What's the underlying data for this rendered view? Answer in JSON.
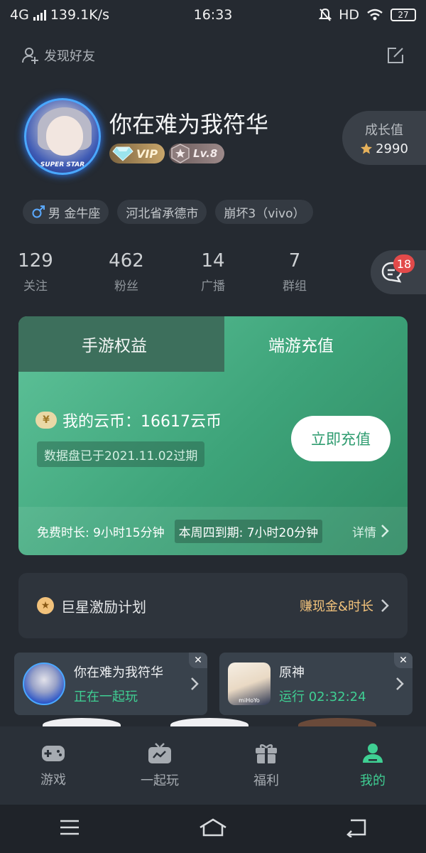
{
  "status_bar": {
    "network": "4G",
    "speed": "139.1K/s",
    "time": "16:33",
    "hd": "HD",
    "battery": "27"
  },
  "header": {
    "find_friends": "发现好友"
  },
  "profile": {
    "username": "你在难为我符华",
    "avatar_text": "SUPER STAR",
    "vip_label": "VIP",
    "level_label": "Lv.8",
    "growth_label": "成长值",
    "growth_value": "2990"
  },
  "tags": [
    {
      "icon": "male-icon",
      "text": "男 金牛座"
    },
    {
      "text": "河北省承德市"
    },
    {
      "text": "崩坏3（vivo）"
    }
  ],
  "stats": [
    {
      "value": "129",
      "label": "关注"
    },
    {
      "value": "462",
      "label": "粉丝"
    },
    {
      "value": "14",
      "label": "广播"
    },
    {
      "value": "7",
      "label": "群组"
    }
  ],
  "messages": {
    "badge": "18"
  },
  "card": {
    "tab_mobile": "手游权益",
    "tab_pc": "端游充值",
    "coin_icon_text": "¥",
    "coins_text": "我的云币：16617云币",
    "expire_text": "数据盘已于2021.11.02过期",
    "recharge_button": "立即充值",
    "free_time": "免费时长: 9小时15分钟",
    "week_expire": "本周四到期: 7小时20分钟",
    "details": "详情"
  },
  "superstar": {
    "label": "巨星激励计划",
    "right_text": "赚现金&时长"
  },
  "play_cards": [
    {
      "title": "你在难为我符华",
      "subtitle": "正在一起玩"
    },
    {
      "title": "原神",
      "subtitle": "运行 02:32:24",
      "thumb_text": "miHoYo"
    }
  ],
  "nav": [
    {
      "label": "游戏",
      "icon": "gamepad-icon"
    },
    {
      "label": "一起玩",
      "icon": "tv-icon"
    },
    {
      "label": "福利",
      "icon": "gift-icon"
    },
    {
      "label": "我的",
      "icon": "user-icon",
      "active": true
    }
  ],
  "colors": {
    "background": "#252a31",
    "accent_green": "#3fcf93",
    "card_green": "#3da379",
    "badge_red": "#e24a4a",
    "gold": "#f2c27b"
  }
}
